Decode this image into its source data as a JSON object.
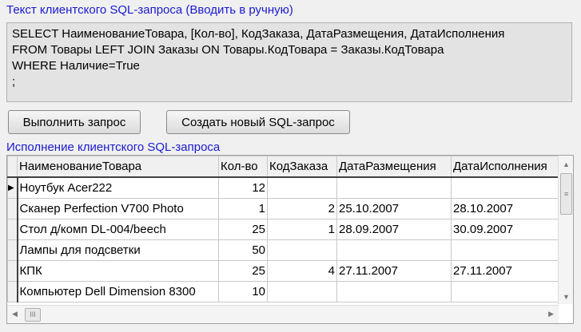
{
  "sql_label": "Текст клиентского SQL-запроса (Вводить в ручную)",
  "sql_lines": [
    "SELECT НаименованиеТовара, [Кол-во], КодЗаказа, ДатаРазмещения, ДатаИсполнения",
    "FROM Товары LEFT JOIN Заказы ON Товары.КодТовара = Заказы.КодТовара",
    "WHERE Наличие=True",
    ";"
  ],
  "buttons": {
    "run": "Выполнить запрос",
    "new": "Создать новый SQL-запрос"
  },
  "result_label": "Исполнение клиентского SQL-запроса",
  "columns": [
    "НаименованиеТовара",
    "Кол-во",
    "КодЗаказа",
    "ДатаРазмещения",
    "ДатаИсполнения"
  ],
  "rows": [
    [
      "Ноутбук Acer222",
      "12",
      "",
      "",
      ""
    ],
    [
      "Сканер Perfection V700 Photo",
      "1",
      "2",
      "25.10.2007",
      "28.10.2007"
    ],
    [
      "Стол д/комп DL-004/beech",
      "25",
      "1",
      "28.09.2007",
      "30.09.2007"
    ],
    [
      "Лампы для подсветки",
      "50",
      "",
      "",
      ""
    ],
    [
      "КПК",
      "25",
      "4",
      "27.11.2007",
      "27.11.2007"
    ],
    [
      "Компьютер Dell Dimension 8300",
      "10",
      "",
      "",
      ""
    ]
  ],
  "current_row_marker": "▶"
}
